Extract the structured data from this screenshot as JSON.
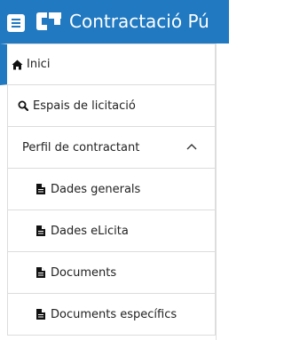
{
  "header": {
    "title": "Contractació Pú",
    "menu_icon": "hamburger-menu-icon",
    "logo_icon": "contractacio-logo-icon"
  },
  "sidebar": {
    "items": [
      {
        "label": "Inici",
        "icon": "home-icon"
      },
      {
        "label": "Espais de licitació",
        "icon": "search-icon"
      },
      {
        "label": "Perfil de contractant",
        "icon": "chevron-up-icon"
      },
      {
        "label": "Dades generals",
        "icon": "file-icon"
      },
      {
        "label": "Dades eLicita",
        "icon": "file-icon"
      },
      {
        "label": "Documents",
        "icon": "file-icon"
      },
      {
        "label": "Documents específics",
        "icon": "file-icon"
      }
    ]
  },
  "colors": {
    "brand_blue": "#2079c1",
    "border": "#dcdcdc",
    "text": "#222222"
  }
}
